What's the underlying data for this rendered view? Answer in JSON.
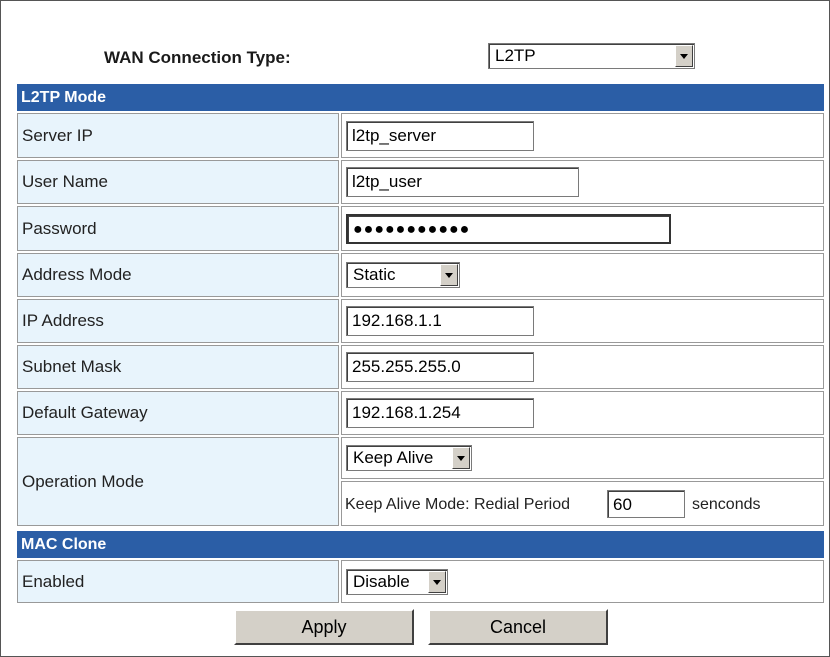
{
  "wan": {
    "label": "WAN Connection Type:",
    "selected": "L2TP"
  },
  "sections": {
    "l2tp_mode": "L2TP Mode",
    "mac_clone": "MAC Clone"
  },
  "fields": {
    "server_ip": {
      "label": "Server IP",
      "value": "l2tp_server"
    },
    "user_name": {
      "label": "User Name",
      "value": "l2tp_user"
    },
    "password": {
      "label": "Password",
      "value": "●●●●●●●●●●●"
    },
    "address_mode": {
      "label": "Address Mode",
      "selected": "Static"
    },
    "ip_address": {
      "label": "IP Address",
      "value": "192.168.1.1"
    },
    "subnet_mask": {
      "label": "Subnet Mask",
      "value": "255.255.255.0"
    },
    "default_gateway": {
      "label": "Default Gateway",
      "value": "192.168.1.254"
    },
    "operation_mode": {
      "label": "Operation Mode",
      "selected": "Keep Alive",
      "redial_label": "Keep Alive Mode: Redial Period",
      "redial_value": "60",
      "redial_unit": "senconds"
    },
    "enabled": {
      "label": "Enabled",
      "selected": "Disable"
    }
  },
  "buttons": {
    "apply": "Apply",
    "cancel": "Cancel"
  },
  "colors": {
    "section_header": "#2b5ea6",
    "label_cell": "#e8f4fc"
  }
}
